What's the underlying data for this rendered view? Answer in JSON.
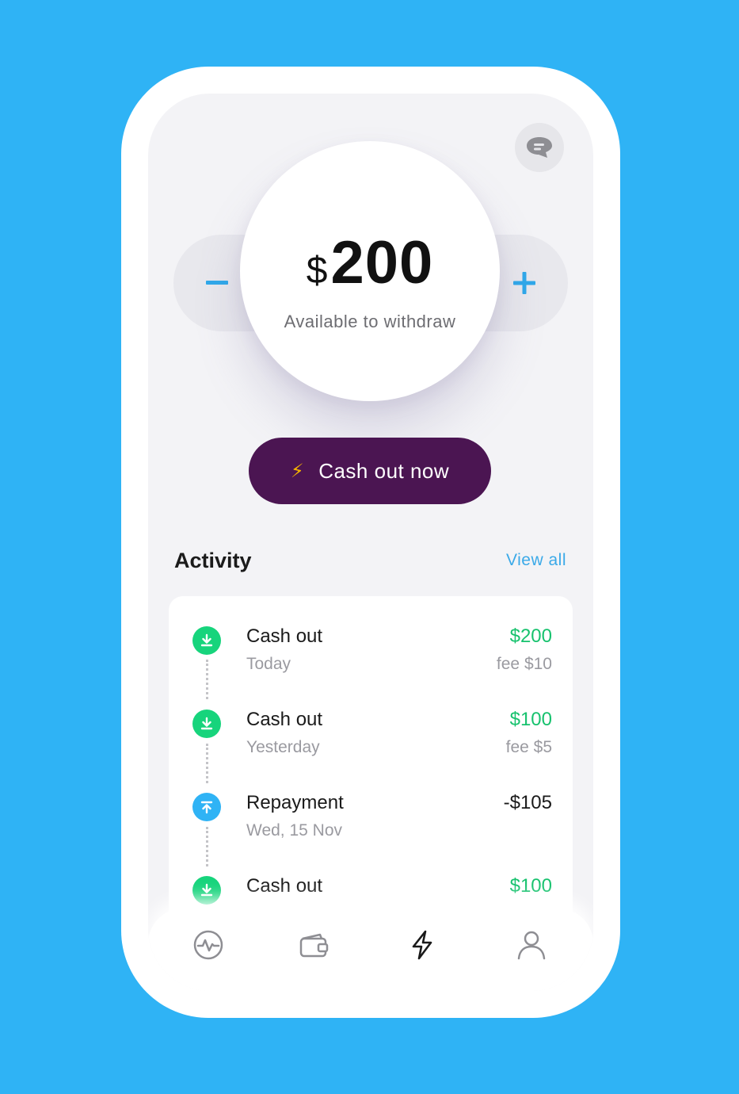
{
  "balance": {
    "currency_symbol": "$",
    "amount": "200",
    "label": "Available to withdraw"
  },
  "controls": {
    "decrease_icon": "minus-icon",
    "increase_icon": "plus-icon"
  },
  "cta": {
    "icon": "lightning-icon",
    "label": "Cash out now"
  },
  "activity": {
    "title": "Activity",
    "view_all": "View all",
    "items": [
      {
        "type": "cash-out",
        "title": "Cash out",
        "date": "Today",
        "amount": "$200",
        "fee": "fee $10",
        "icon": "download-icon"
      },
      {
        "type": "cash-out",
        "title": "Cash out",
        "date": "Yesterday",
        "amount": "$100",
        "fee": "fee $5",
        "icon": "download-icon"
      },
      {
        "type": "repayment",
        "title": "Repayment",
        "date": "Wed, 15 Nov",
        "amount": "-$105",
        "fee": "",
        "icon": "upload-icon"
      },
      {
        "type": "cash-out",
        "title": "Cash out",
        "date": "",
        "amount": "$100",
        "fee": "",
        "icon": "download-icon"
      }
    ]
  },
  "nav": {
    "items": [
      {
        "icon": "activity-pulse-icon",
        "active": false
      },
      {
        "icon": "wallet-icon",
        "active": false
      },
      {
        "icon": "lightning-icon",
        "active": true
      },
      {
        "icon": "profile-icon",
        "active": false
      }
    ]
  },
  "colors": {
    "background": "#2fb3f5",
    "cta": "#4b1552",
    "positive": "#17c26e",
    "accent": "#3aa9e8"
  }
}
